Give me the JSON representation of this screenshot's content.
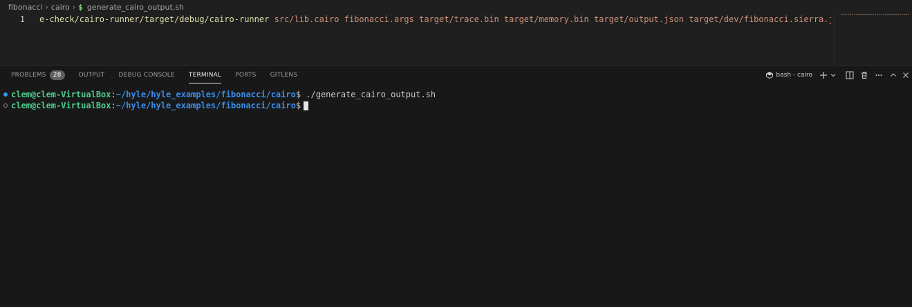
{
  "breadcrumb": {
    "items": [
      "fibonacci",
      "cairo"
    ],
    "file_icon": "$",
    "file_name": "generate_cairo_output.sh"
  },
  "editor": {
    "line_number": "1",
    "code_cmd": "e-check/cairo-runner/target/debug/cairo-runner",
    "code_args": "src/lib.cairo fibonacci.args target/trace.bin target/memory.bin target/output.json target/dev/fibonacci.sierra.json"
  },
  "panel": {
    "tabs": [
      {
        "label": "PROBLEMS",
        "badge": "28"
      },
      {
        "label": "OUTPUT"
      },
      {
        "label": "DEBUG CONSOLE"
      },
      {
        "label": "TERMINAL",
        "active": true
      },
      {
        "label": "PORTS"
      },
      {
        "label": "GITLENS"
      }
    ],
    "terminal_instance": "bash - cairo"
  },
  "terminal": {
    "lines": [
      {
        "user": "clem@clem-VirtualBox",
        "colon": ":",
        "path": "~/hyle/hyle_examples/fibonacci/cairo",
        "dollar": "$",
        "command": " ./generate_cairo_output.sh"
      },
      {
        "user": "clem@clem-VirtualBox",
        "colon": ":",
        "path": "~/hyle/hyle_examples/fibonacci/cairo",
        "dollar": "$",
        "command": ""
      }
    ]
  },
  "colors": {
    "background": "#1f1f1f",
    "panel_background": "#181818",
    "prompt_user": "#4ec98c",
    "prompt_path": "#3b8eea",
    "decoration_success": "#3794ff",
    "badge": "#616161"
  }
}
